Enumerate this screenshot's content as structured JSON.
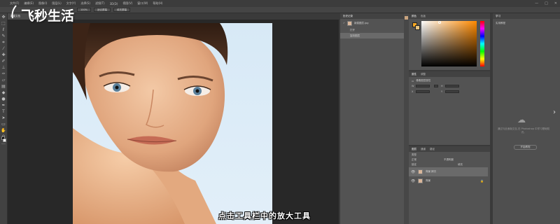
{
  "menu": {
    "items": [
      "文件(F)",
      "编辑(E)",
      "图像(I)",
      "图层(L)",
      "文字(Y)",
      "选择(S)",
      "滤镜(T)",
      "3D(D)",
      "视图(V)",
      "窗口(W)",
      "帮助(H)"
    ]
  },
  "window_controls": [
    "—",
    "□",
    "✕"
  ],
  "options_bar": {
    "zoom": "100%",
    "fit_screen": "适合屏幕",
    "fill_screen": "填充屏幕"
  },
  "document": {
    "tab_label": "新建文档"
  },
  "history_panel": {
    "tabs": [
      "历史记录"
    ],
    "snapshot": "新建图层.jpg",
    "steps": [
      "打开",
      "复制图层"
    ]
  },
  "color_panel": {
    "tabs": [
      "颜色",
      "色板"
    ]
  },
  "properties_panel": {
    "tabs": [
      "属性",
      "调整"
    ],
    "title": "像素图层属性",
    "w_label": "W",
    "h_label": "H",
    "x_label": "X",
    "y_label": "Y"
  },
  "layers_panel": {
    "tabs": [
      "图层",
      "通道",
      "路径"
    ],
    "kind": "类型",
    "blend_mode": "正常",
    "opacity_label": "不透明度",
    "lock_label": "锁定",
    "fill_label": "填充",
    "layers": [
      {
        "name": "背景 拷贝",
        "selected": true
      },
      {
        "name": "背景",
        "selected": false
      }
    ]
  },
  "learn_panel": {
    "tab": "学习",
    "title": "实用教程",
    "hint": "通过与此面板交互,在 Photoshop 中学习基础知识。",
    "button": "开始教程"
  },
  "watermark": "飞秒生活",
  "subtitle": "点击工具栏中的放大工具"
}
